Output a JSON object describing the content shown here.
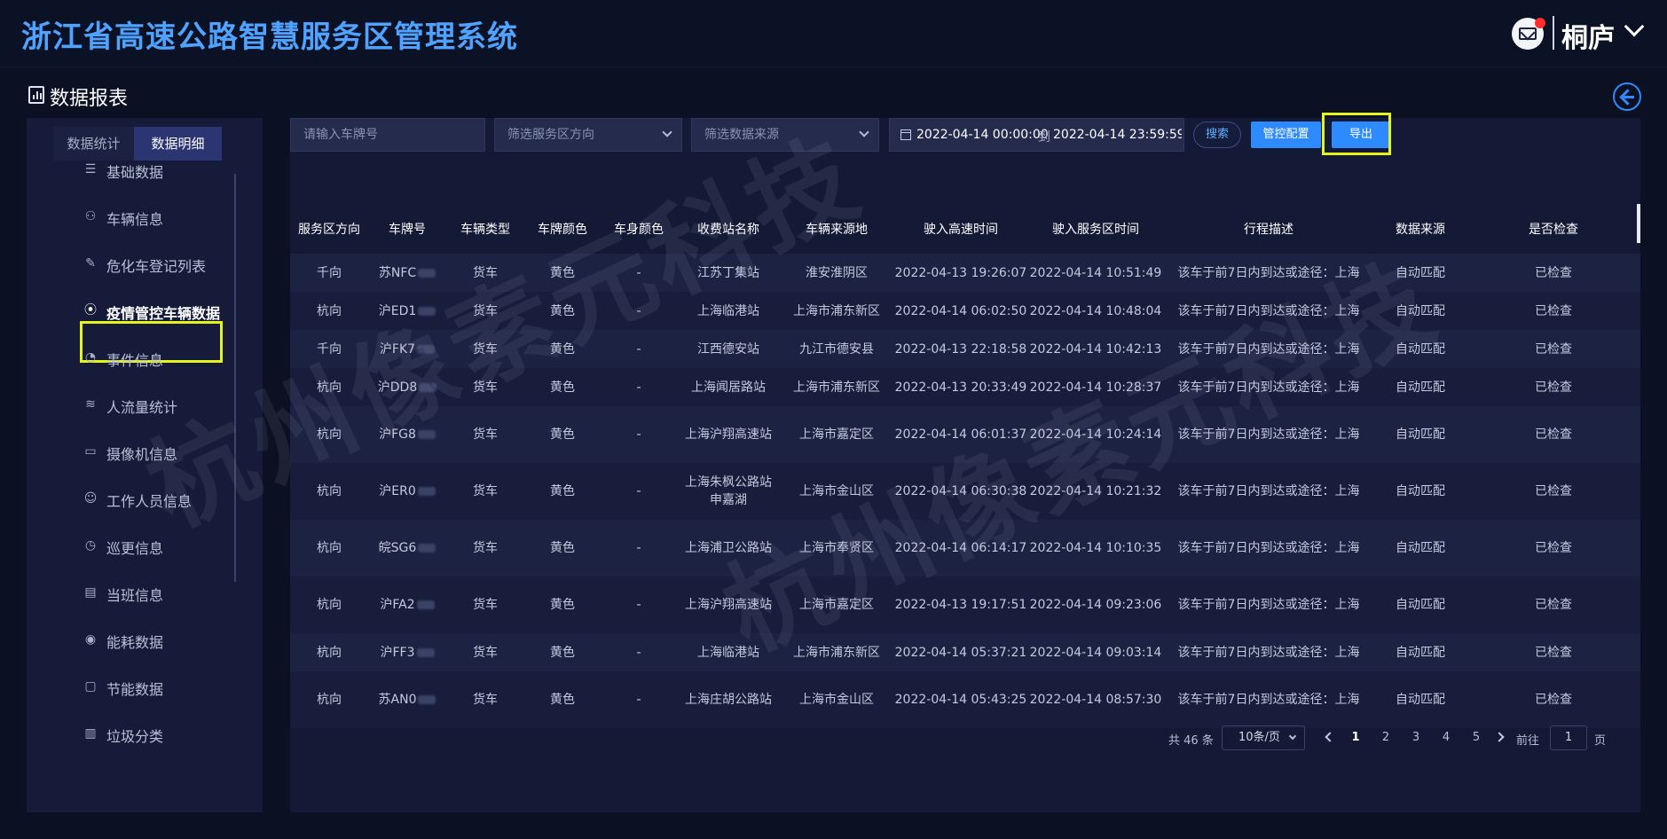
{
  "header": {
    "title": "浙江省高速公路智慧服务区管理系统",
    "user_name": "桐庐",
    "icons": {
      "mail": "mail-icon",
      "user_menu": "chevron-down-icon"
    }
  },
  "page": {
    "title": "数据报表",
    "icons": {
      "title": "report-icon",
      "back": "back-arrow-icon"
    }
  },
  "sidebar": {
    "tabs": [
      {
        "label": "数据统计",
        "active": false
      },
      {
        "label": "数据明细",
        "active": true
      }
    ],
    "items": [
      {
        "label": "基础数据",
        "icon": "database-icon"
      },
      {
        "label": "车辆信息",
        "icon": "car-person-icon"
      },
      {
        "label": "危化车登记列表",
        "icon": "edit-icon"
      },
      {
        "label": "疫情管控车辆数据",
        "icon": "location-pin-icon",
        "active": true
      },
      {
        "label": "事件信息",
        "icon": "event-icon"
      },
      {
        "label": "人流量统计",
        "icon": "layers-icon"
      },
      {
        "label": "摄像机信息",
        "icon": "camera-icon"
      },
      {
        "label": "工作人员信息",
        "icon": "staff-icon"
      },
      {
        "label": "巡更信息",
        "icon": "clock-icon"
      },
      {
        "label": "当班信息",
        "icon": "duty-icon"
      },
      {
        "label": "能耗数据",
        "icon": "energy-icon"
      },
      {
        "label": "节能数据",
        "icon": "message-icon"
      },
      {
        "label": "垃圾分类",
        "icon": "trash-icon"
      }
    ]
  },
  "filters": {
    "plate_placeholder": "请输入车牌号",
    "direction_placeholder": "筛选服务区方向",
    "source_placeholder": "筛选数据来源",
    "date_start": "2022-04-14 00:00:00",
    "date_separator": "到",
    "date_end": "2022-04-14 23:59:59",
    "search_label": "搜索",
    "config_label": "管控配置",
    "export_label": "导出"
  },
  "table": {
    "columns": [
      "服务区方向",
      "车牌号",
      "车辆类型",
      "车牌颜色",
      "车身颜色",
      "收费站名称",
      "车辆来源地",
      "驶入高速时间",
      "驶入服务区时间",
      "行程描述",
      "数据来源",
      "是否检查"
    ],
    "rows": [
      [
        "千向",
        "苏NFC",
        "货车",
        "黄色",
        "-",
        "江苏丁集站",
        "淮安淮阴区",
        "2022-04-13 19:26:07",
        "2022-04-14 10:51:49",
        "该车于前7日内到达或途径：上海",
        "自动匹配",
        "已检查"
      ],
      [
        "杭向",
        "沪ED1",
        "货车",
        "黄色",
        "-",
        "上海临港站",
        "上海市浦东新区",
        "2022-04-14 06:02:50",
        "2022-04-14 10:48:04",
        "该车于前7日内到达或途径：上海",
        "自动匹配",
        "已检查"
      ],
      [
        "千向",
        "沪FK7",
        "货车",
        "黄色",
        "-",
        "江西德安站",
        "九江市德安县",
        "2022-04-13 22:18:58",
        "2022-04-14 10:42:13",
        "该车于前7日内到达或途径：上海",
        "自动匹配",
        "已检查"
      ],
      [
        "杭向",
        "沪DD8",
        "货车",
        "黄色",
        "-",
        "上海闻居路站",
        "上海市浦东新区",
        "2022-04-13 20:33:49",
        "2022-04-14 10:28:37",
        "该车于前7日内到达或途径：上海",
        "自动匹配",
        "已检查"
      ],
      [
        "杭向",
        "沪FG8",
        "货车",
        "黄色",
        "-",
        "上海沪翔高速站",
        "上海市嘉定区",
        "2022-04-14 06:01:37",
        "2022-04-14 10:24:14",
        "该车于前7日内到达或途径：上海",
        "自动匹配",
        "已检查"
      ],
      [
        "杭向",
        "沪ER0",
        "货车",
        "黄色",
        "-",
        "上海朱枫公路站申嘉湖",
        "上海市金山区",
        "2022-04-14 06:30:38",
        "2022-04-14 10:21:32",
        "该车于前7日内到达或途径：上海",
        "自动匹配",
        "已检查"
      ],
      [
        "杭向",
        "皖SG6",
        "货车",
        "黄色",
        "-",
        "上海浦卫公路站",
        "上海市奉贤区",
        "2022-04-14 06:14:17",
        "2022-04-14 10:10:35",
        "该车于前7日内到达或途径：上海",
        "自动匹配",
        "已检查"
      ],
      [
        "杭向",
        "沪FA2",
        "货车",
        "黄色",
        "-",
        "上海沪翔高速站",
        "上海市嘉定区",
        "2022-04-13 19:17:51",
        "2022-04-14 09:23:06",
        "该车于前7日内到达或途径：上海",
        "自动匹配",
        "已检查"
      ],
      [
        "杭向",
        "沪FF3",
        "货车",
        "黄色",
        "-",
        "上海临港站",
        "上海市浦东新区",
        "2022-04-14 05:37:21",
        "2022-04-14 09:03:14",
        "该车于前7日内到达或途径：上海",
        "自动匹配",
        "已检查"
      ],
      [
        "杭向",
        "苏AN0",
        "货车",
        "黄色",
        "-",
        "上海庄胡公路站",
        "上海市金山区",
        "2022-04-14 05:43:25",
        "2022-04-14 08:57:30",
        "该车于前7日内到达或途径：上海",
        "自动匹配",
        "已检查"
      ]
    ]
  },
  "pagination": {
    "total": "共 46 条",
    "page_size": "10条/页",
    "pages": [
      "1",
      "2",
      "3",
      "4",
      "5"
    ],
    "current": "1",
    "goto_label": "前往",
    "goto_value": "1",
    "page_unit": "页"
  },
  "watermark": {
    "text": "杭州像素元科技"
  },
  "colors": {
    "accent": "#2d8bff",
    "title": "#4fa3ff",
    "highlight": "#e5f51a",
    "background": "#0b1022"
  }
}
